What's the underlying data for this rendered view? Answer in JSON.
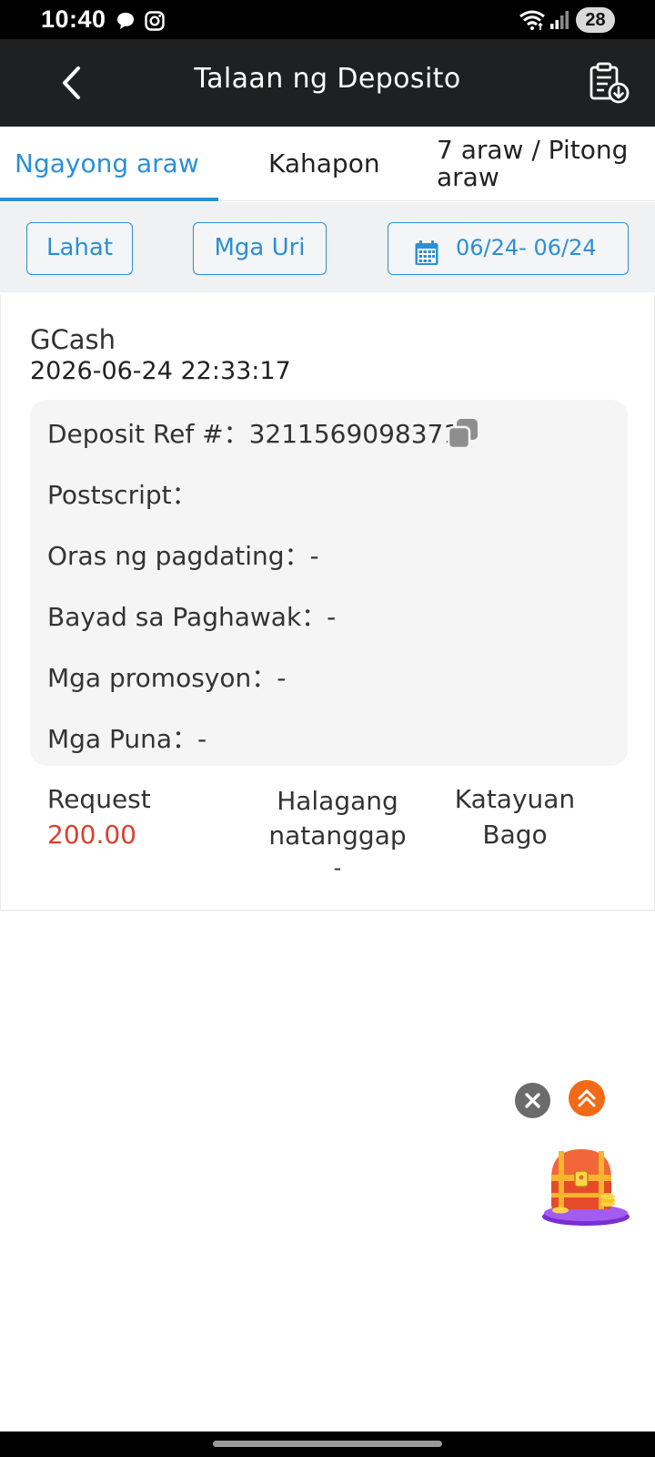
{
  "status_bar": {
    "time": "10:40",
    "battery": "28",
    "icons": [
      "chat-bubble-icon",
      "instagram-icon",
      "wifi-icon",
      "signal-icon"
    ]
  },
  "header": {
    "title": "Talaan ng Deposito",
    "back_icon": "chevron-left-icon",
    "action_icon": "clipboard-download-icon"
  },
  "tabs": [
    {
      "label": "Ngayong araw",
      "active": true
    },
    {
      "label": "Kahapon",
      "active": false
    },
    {
      "label": "7 araw / Pitong araw",
      "active": false
    }
  ],
  "filters": {
    "all": "Lahat",
    "types": "Mga Uri",
    "date_range": "06/24- 06/24",
    "date_icon": "calendar-icon"
  },
  "record": {
    "method": "GCash",
    "datetime": "2026-06-24 22:33:17",
    "details": {
      "ref_label": "Deposit Ref #：",
      "ref_value": "3211569098371",
      "postscript_label": "Postscript：",
      "postscript_value": "",
      "arrival_label": "Oras ng pagdating：",
      "arrival_value": "-",
      "fee_label": "Bayad sa Paghawak：",
      "fee_value": "-",
      "promo_label": "Mga promosyon：",
      "promo_value": "-",
      "remarks_label": "Mga Puna：",
      "remarks_value": "-"
    },
    "summary": {
      "request_label": "Request",
      "request_value": "200.00",
      "received_label": "Halagang natanggap",
      "received_value": "-",
      "status_label": "Katayuan",
      "status_value": "Bago"
    }
  },
  "colors": {
    "accent": "#2b8fd6",
    "amount": "#d9412f",
    "header_bg": "#1f2021",
    "float_up": "#f26a17"
  }
}
